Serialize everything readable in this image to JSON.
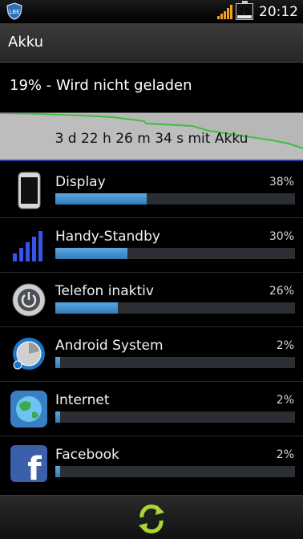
{
  "status_bar": {
    "app_badge_icon": "lbe-shield-icon",
    "signal_icon": "signal-strength-icon",
    "battery_level": "19",
    "time": "20:12"
  },
  "header": {
    "title": "Akku"
  },
  "battery": {
    "status_text": "19% - Wird nicht geladen",
    "graph_caption": "3 d 22 h 26 m 34 s mit Akku"
  },
  "usage": [
    {
      "name": "Display",
      "percent_label": "38%",
      "percent": 38,
      "icon": "phone-display-icon"
    },
    {
      "name": "Handy-Standby",
      "percent_label": "30%",
      "percent": 30,
      "icon": "cell-signal-icon"
    },
    {
      "name": "Telefon inaktiv",
      "percent_label": "26%",
      "percent": 26,
      "icon": "power-button-icon"
    },
    {
      "name": "Android System",
      "percent_label": "2%",
      "percent": 2,
      "icon": "android-system-icon"
    },
    {
      "name": "Internet",
      "percent_label": "2%",
      "percent": 2,
      "icon": "globe-icon"
    },
    {
      "name": "Facebook",
      "percent_label": "2%",
      "percent": 2,
      "icon": "facebook-icon"
    }
  ],
  "footer": {
    "refresh_icon": "refresh-icon"
  },
  "colors": {
    "bar_fill": "#3f8fce",
    "graph_line": "#3fbf3f",
    "graph_bg": "#b7b7b7"
  }
}
